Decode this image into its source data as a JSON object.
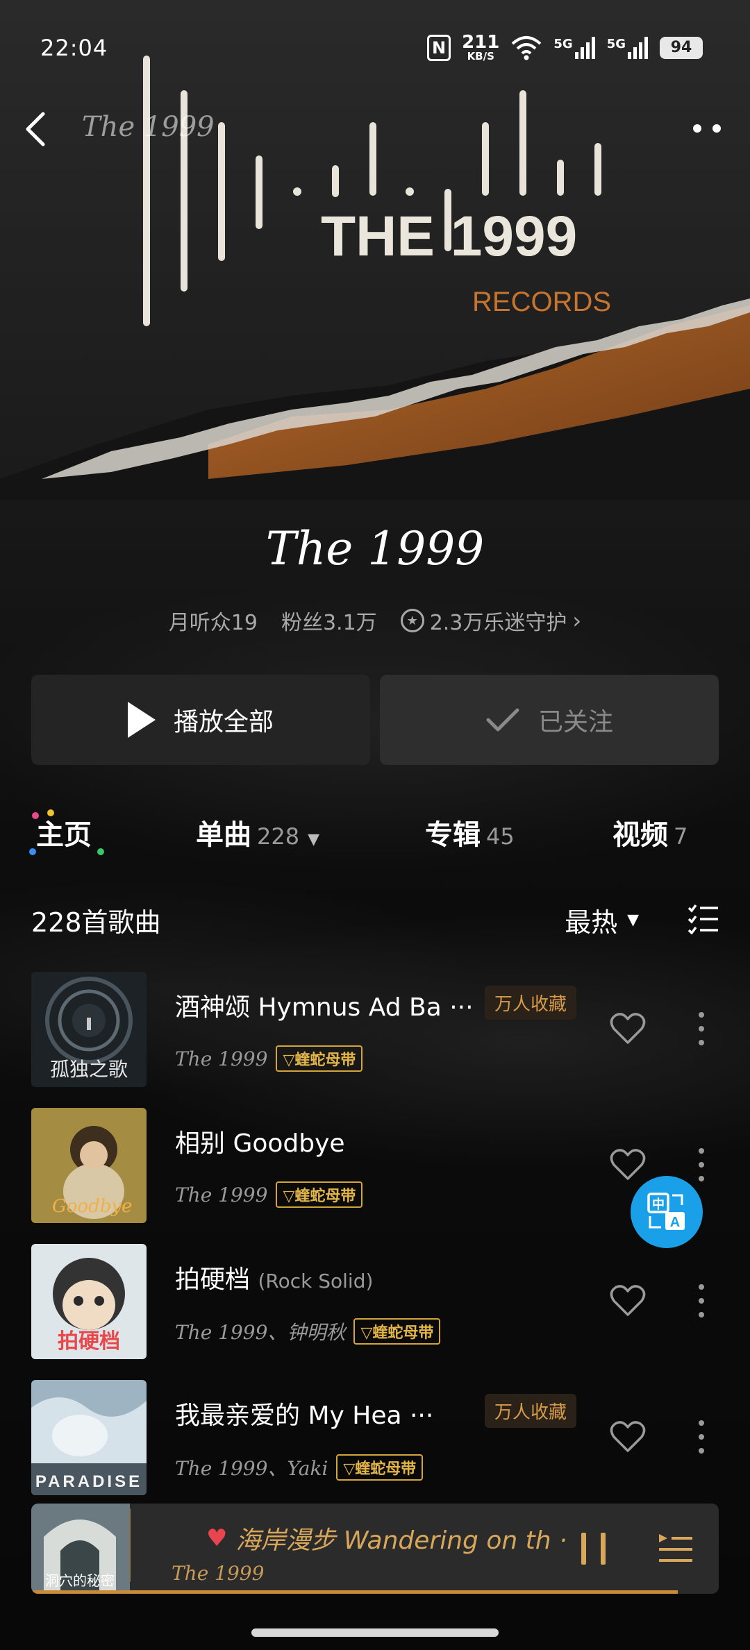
{
  "status": {
    "time": "22:04",
    "nfc": "N",
    "speed_value": "211",
    "speed_unit": "KB/S",
    "signal1": "5G",
    "signal2": "5G",
    "battery": "94"
  },
  "nav": {
    "title": "The 1999"
  },
  "banner": {
    "logo_text": "THE 1999",
    "logo_sub": "RECORDS"
  },
  "artist": {
    "name": "The 1999",
    "monthly_listeners": "月听众19",
    "fans": "粉丝3.1万",
    "guard": "2.3万乐迷守护",
    "guard_chevron": "›"
  },
  "buttons": {
    "play_all": "播放全部",
    "followed": "已关注"
  },
  "tabs": [
    {
      "label": "主页",
      "count": ""
    },
    {
      "label": "单曲",
      "count": "228"
    },
    {
      "label": "专辑",
      "count": "45"
    },
    {
      "label": "视频",
      "count": "7"
    }
  ],
  "list": {
    "count_label": "228首歌曲",
    "sort_label": "最热"
  },
  "songs": [
    {
      "title": "酒神颂 Hymnus Ad Ba ···",
      "title_sub": "",
      "badge": "万人收藏",
      "artist": "The 1999",
      "vip": "蝰蛇母带",
      "cover_text": "孤独之歌"
    },
    {
      "title": "相别 Goodbye",
      "title_sub": "",
      "badge": "",
      "artist": "The 1999",
      "vip": "蝰蛇母带",
      "cover_text": "Goodbye"
    },
    {
      "title": "拍硬档",
      "title_sub": "(Rock Solid)",
      "badge": "",
      "artist": "The 1999、钟明秋",
      "vip": "蝰蛇母带",
      "cover_text": "拍硬档"
    },
    {
      "title": "我最亲爱的 My Hea ···",
      "title_sub": "",
      "badge": "万人收藏",
      "artist": "The 1999、Yaki",
      "vip": "蝰蛇母带",
      "cover_text": "PARADISE"
    }
  ],
  "player": {
    "title": "海岸漫步 Wandering on th ···",
    "artist": "The 1999",
    "cover_text": "洞穴的秘密",
    "progress": 0.94
  },
  "colors": {
    "accent_gold": "#d9a75a",
    "vip_gold": "#e3b547",
    "fab_blue": "#1aa0e8",
    "banner_orange": "#b5662a"
  }
}
